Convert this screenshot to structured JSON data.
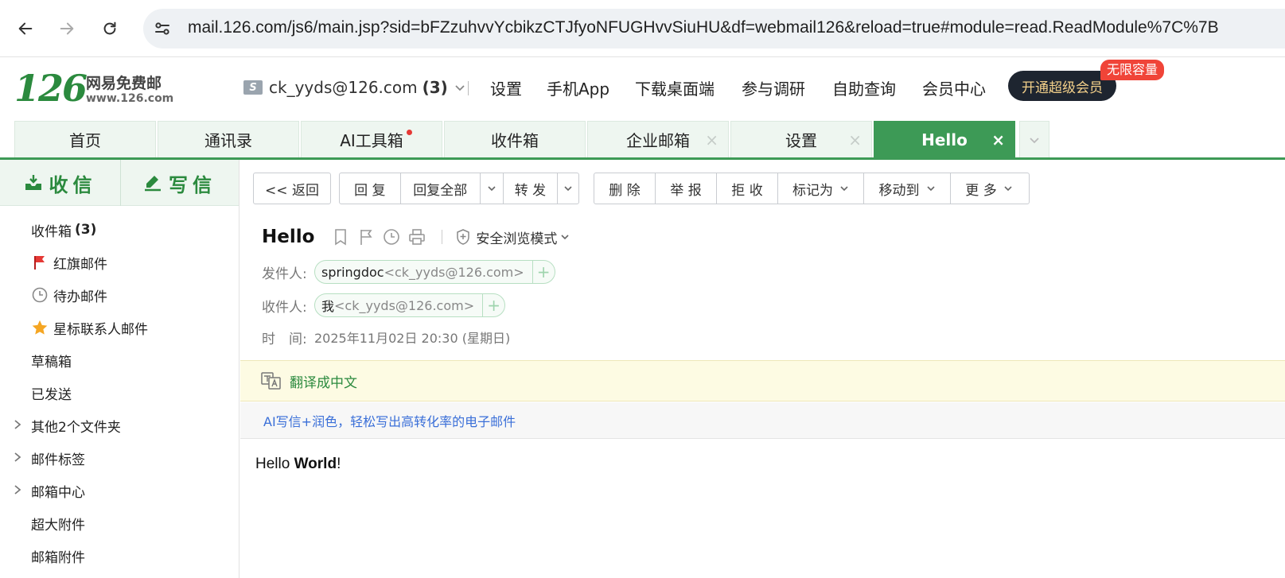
{
  "browser": {
    "url": "mail.126.com/js6/main.jsp?sid=bFZzuhvvYcbikzCTJfyoNFUGHvvSiuHU&df=webmail126&reload=true#module=read.ReadModule%7C%7B"
  },
  "header": {
    "logo_num": "126",
    "logo_cn": "网易免费邮",
    "logo_en": "www.126.com",
    "account_email": "ck_yyds@126.com",
    "account_count": "(3)",
    "links": [
      "设置",
      "手机App",
      "下载桌面端",
      "参与调研",
      "自助查询",
      "会员中心"
    ],
    "vip_button": "开通超级会员",
    "vip_badge": "无限容量"
  },
  "tabs": [
    {
      "label": "首页"
    },
    {
      "label": "通讯录"
    },
    {
      "label": "AI工具箱"
    },
    {
      "label": "收件箱"
    },
    {
      "label": "企业邮箱"
    },
    {
      "label": "设置"
    },
    {
      "label": "Hello"
    }
  ],
  "sidebar": {
    "receive_label": "收信",
    "write_label": "写信",
    "folders": [
      {
        "label": "收件箱",
        "count": "(3)"
      },
      {
        "label": "红旗邮件"
      },
      {
        "label": "待办邮件"
      },
      {
        "label": "星标联系人邮件"
      },
      {
        "label": "草稿箱"
      },
      {
        "label": "已发送"
      },
      {
        "label": "其他2个文件夹"
      },
      {
        "label": "邮件标签"
      },
      {
        "label": "邮箱中心"
      },
      {
        "label": "超大附件"
      },
      {
        "label": "邮箱附件"
      }
    ]
  },
  "toolbar": {
    "back": "<< 返回",
    "reply": "回 复",
    "reply_all": "回复全部",
    "forward": "转 发",
    "delete": "删 除",
    "report": "举 报",
    "reject": "拒 收",
    "mark_as": "标记为",
    "move_to": "移动到",
    "more": "更 多"
  },
  "mail": {
    "subject": "Hello",
    "safe_mode": "安全浏览模式",
    "from_label": "发件人:",
    "from_name": "springdoc",
    "from_email": "<ck_yyds@126.com>",
    "to_label": "收件人:",
    "to_name": "我",
    "to_email": "<ck_yyds@126.com>",
    "time_label": "时　间:",
    "time_value": "2025年11月02日 20:30 (星期日)",
    "translate": "翻译成中文",
    "ai_promo": "AI写信+润色，轻松写出高转化率的电子邮件",
    "body_plain": "Hello ",
    "body_bold": "World",
    "body_end": "!"
  },
  "colors": {
    "brand_green": "#3d9a56",
    "link_blue": "#3a6fd8",
    "vip_dark": "#1e2530",
    "badge_red": "#f04438"
  }
}
